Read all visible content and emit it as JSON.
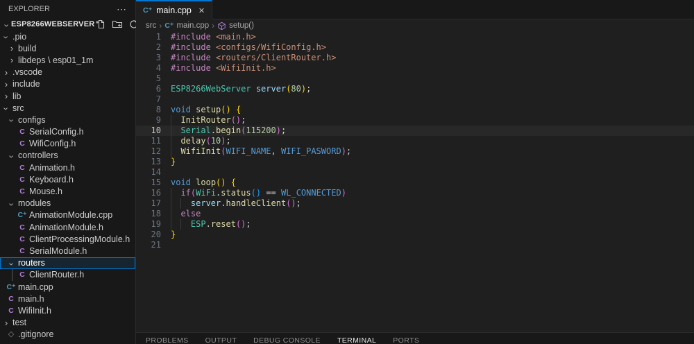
{
  "colors": {
    "accent": "#0078d4",
    "sidebar_bg": "#181818",
    "editor_bg": "#1f1f1f",
    "tokens": {
      "pp": "#C586C0",
      "str": "#CE9178",
      "cls": "#4EC9B0",
      "var": "#9CDCFE",
      "fn": "#DCDCAA",
      "kw": "#569CD6",
      "kwc": "#C586C0",
      "const": "#569CD6",
      "num": "#B5CEA8",
      "pl": "#D4D4D4",
      "b1": "#FFD700",
      "b2": "#DA70D6",
      "b3": "#179FFF"
    },
    "file_icon_c": "#b180d7",
    "file_icon_cpp": "#519aba"
  },
  "explorer": {
    "title": "EXPLORER",
    "more_icon": "⋯",
    "section_name": "ESP8266WEBSERVER",
    "actions": [
      {
        "icon": "new-file-icon"
      },
      {
        "icon": "new-folder-icon"
      },
      {
        "icon": "refresh-icon"
      },
      {
        "icon": "collapse-folders-icon"
      }
    ],
    "tree": [
      {
        "label": ".pio",
        "depth": 1,
        "kind": "folder",
        "state": "open"
      },
      {
        "label": "build",
        "depth": 2,
        "kind": "folder",
        "state": "closed"
      },
      {
        "label": "libdeps \\ esp01_1m",
        "depth": 2,
        "kind": "folder",
        "state": "closed"
      },
      {
        "label": ".vscode",
        "depth": 1,
        "kind": "folder",
        "state": "closed"
      },
      {
        "label": "include",
        "depth": 1,
        "kind": "folder",
        "state": "closed"
      },
      {
        "label": "lib",
        "depth": 1,
        "kind": "folder",
        "state": "closed"
      },
      {
        "label": "src",
        "depth": 1,
        "kind": "folder",
        "state": "open"
      },
      {
        "label": "configs",
        "depth": 2,
        "kind": "folder",
        "state": "open"
      },
      {
        "label": "SerialConfig.h",
        "depth": 3,
        "kind": "file",
        "icon": "c"
      },
      {
        "label": "WifiConfig.h",
        "depth": 3,
        "kind": "file",
        "icon": "c"
      },
      {
        "label": "controllers",
        "depth": 2,
        "kind": "folder",
        "state": "open"
      },
      {
        "label": "Animation.h",
        "depth": 3,
        "kind": "file",
        "icon": "c"
      },
      {
        "label": "Keyboard.h",
        "depth": 3,
        "kind": "file",
        "icon": "c"
      },
      {
        "label": "Mouse.h",
        "depth": 3,
        "kind": "file",
        "icon": "c"
      },
      {
        "label": "modules",
        "depth": 2,
        "kind": "folder",
        "state": "open"
      },
      {
        "label": "AnimationModule.cpp",
        "depth": 3,
        "kind": "file",
        "icon": "cpp"
      },
      {
        "label": "AnimationModule.h",
        "depth": 3,
        "kind": "file",
        "icon": "c"
      },
      {
        "label": "ClientProcessingModule.h",
        "depth": 3,
        "kind": "file",
        "icon": "c"
      },
      {
        "label": "SerialModule.h",
        "depth": 3,
        "kind": "file",
        "icon": "c"
      },
      {
        "label": "routers",
        "depth": 2,
        "kind": "folder",
        "state": "open",
        "selected": true
      },
      {
        "label": "ClientRouter.h",
        "depth": 3,
        "kind": "file",
        "icon": "c",
        "guide": true
      },
      {
        "label": "main.cpp",
        "depth": 1,
        "kind": "file",
        "icon": "cpp"
      },
      {
        "label": "main.h",
        "depth": 1,
        "kind": "file",
        "icon": "c"
      },
      {
        "label": "WifiInit.h",
        "depth": 1,
        "kind": "file",
        "icon": "c"
      },
      {
        "label": "test",
        "depth": 1,
        "kind": "folder",
        "state": "closed"
      },
      {
        "label": ".gitignore",
        "depth": 1,
        "kind": "file",
        "icon": "git"
      }
    ]
  },
  "editor": {
    "tab": {
      "label": "main.cpp",
      "icon": "cpp-file-icon",
      "close_icon": "✕"
    },
    "breadcrumb": [
      {
        "label": "src"
      },
      {
        "label": "main.cpp",
        "icon": "cpp-file-icon"
      },
      {
        "label": "setup()",
        "icon": "symbol-method-icon"
      }
    ],
    "active_line": 10,
    "code_lines": [
      {
        "n": 1,
        "t": [
          [
            "#include",
            "pp"
          ],
          [
            " ",
            "pl"
          ],
          [
            "<main.h>",
            "str"
          ]
        ]
      },
      {
        "n": 2,
        "t": [
          [
            "#include",
            "pp"
          ],
          [
            " ",
            "pl"
          ],
          [
            "<configs/WifiConfig.h>",
            "str"
          ]
        ]
      },
      {
        "n": 3,
        "t": [
          [
            "#include",
            "pp"
          ],
          [
            " ",
            "pl"
          ],
          [
            "<routers/ClientRouter.h>",
            "str"
          ]
        ]
      },
      {
        "n": 4,
        "t": [
          [
            "#include",
            "pp"
          ],
          [
            " ",
            "pl"
          ],
          [
            "<WifiInit.h>",
            "str"
          ]
        ]
      },
      {
        "n": 5,
        "t": []
      },
      {
        "n": 6,
        "t": [
          [
            "ESP8266WebServer",
            "cls"
          ],
          [
            " ",
            "pl"
          ],
          [
            "server",
            "var"
          ],
          [
            "(",
            "b1"
          ],
          [
            "80",
            "num"
          ],
          [
            ")",
            "b1"
          ],
          [
            ";",
            "pl"
          ]
        ]
      },
      {
        "n": 7,
        "t": []
      },
      {
        "n": 8,
        "t": [
          [
            "void",
            "kw"
          ],
          [
            " ",
            "pl"
          ],
          [
            "setup",
            "fn"
          ],
          [
            "()",
            "b1"
          ],
          [
            " ",
            "pl"
          ],
          [
            "{",
            "b1"
          ]
        ]
      },
      {
        "n": 9,
        "t": [
          [
            "  ",
            "pl"
          ],
          [
            "InitRouter",
            "fn"
          ],
          [
            "()",
            "b2"
          ],
          [
            ";",
            "pl"
          ]
        ]
      },
      {
        "n": 10,
        "t": [
          [
            "  ",
            "pl"
          ],
          [
            "Serial",
            "cls"
          ],
          [
            ".",
            "pl"
          ],
          [
            "begin",
            "fn"
          ],
          [
            "(",
            "b2"
          ],
          [
            "115200",
            "num"
          ],
          [
            ")",
            "b2"
          ],
          [
            ";",
            "pl"
          ]
        ]
      },
      {
        "n": 11,
        "t": [
          [
            "  ",
            "pl"
          ],
          [
            "delay",
            "fn"
          ],
          [
            "(",
            "b2"
          ],
          [
            "10",
            "num"
          ],
          [
            ")",
            "b2"
          ],
          [
            ";",
            "pl"
          ]
        ]
      },
      {
        "n": 12,
        "t": [
          [
            "  ",
            "pl"
          ],
          [
            "WifiInit",
            "fn"
          ],
          [
            "(",
            "b2"
          ],
          [
            "WIFI_NAME",
            "const"
          ],
          [
            ",",
            "pl"
          ],
          [
            " ",
            "pl"
          ],
          [
            "WIFI_PASWORD",
            "const"
          ],
          [
            ")",
            "b2"
          ],
          [
            ";",
            "pl"
          ]
        ]
      },
      {
        "n": 13,
        "t": [
          [
            "}",
            "b1"
          ]
        ]
      },
      {
        "n": 14,
        "t": []
      },
      {
        "n": 15,
        "t": [
          [
            "void",
            "kw"
          ],
          [
            " ",
            "pl"
          ],
          [
            "loop",
            "fn"
          ],
          [
            "()",
            "b1"
          ],
          [
            " ",
            "pl"
          ],
          [
            "{",
            "b1"
          ]
        ]
      },
      {
        "n": 16,
        "t": [
          [
            "  ",
            "pl"
          ],
          [
            "if",
            "kwc"
          ],
          [
            "(",
            "b2"
          ],
          [
            "WiFi",
            "cls"
          ],
          [
            ".",
            "pl"
          ],
          [
            "status",
            "fn"
          ],
          [
            "()",
            "b3"
          ],
          [
            " ",
            "pl"
          ],
          [
            "==",
            "pl"
          ],
          [
            " ",
            "pl"
          ],
          [
            "WL_CONNECTED",
            "const"
          ],
          [
            ")",
            "b2"
          ]
        ]
      },
      {
        "n": 17,
        "t": [
          [
            "    ",
            "pl"
          ],
          [
            "server",
            "var"
          ],
          [
            ".",
            "pl"
          ],
          [
            "handleClient",
            "fn"
          ],
          [
            "()",
            "b2"
          ],
          [
            ";",
            "pl"
          ]
        ]
      },
      {
        "n": 18,
        "t": [
          [
            "  ",
            "pl"
          ],
          [
            "else",
            "kwc"
          ]
        ]
      },
      {
        "n": 19,
        "t": [
          [
            "    ",
            "pl"
          ],
          [
            "ESP",
            "cls"
          ],
          [
            ".",
            "pl"
          ],
          [
            "reset",
            "fn"
          ],
          [
            "()",
            "b2"
          ],
          [
            ";",
            "pl"
          ]
        ]
      },
      {
        "n": 20,
        "t": [
          [
            "}",
            "b1"
          ]
        ]
      },
      {
        "n": 21,
        "t": []
      }
    ]
  },
  "panel": {
    "tabs": [
      {
        "label": "PROBLEMS"
      },
      {
        "label": "OUTPUT"
      },
      {
        "label": "DEBUG CONSOLE"
      },
      {
        "label": "TERMINAL",
        "active": true
      },
      {
        "label": "PORTS"
      }
    ]
  }
}
